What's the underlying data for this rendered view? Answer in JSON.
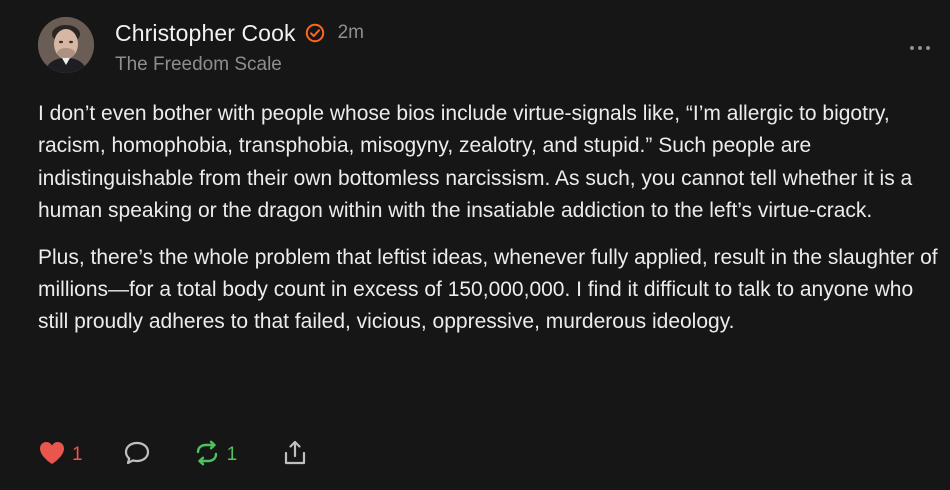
{
  "post": {
    "author_name": "Christopher Cook",
    "timestamp": "2m",
    "publication": "The Freedom Scale",
    "paragraphs": [
      "I don’t even bother with people whose bios include virtue-signals like, “I’m allergic to bigotry, racism, homophobia, transphobia, misogyny, zealotry, and stupid.” Such people are indistinguishable from their own bottomless narcissism. As such, you cannot tell whether it is a human speaking or the dragon within with the insatiable addiction to the left’s virtue-crack.",
      "Plus, there’s the whole problem that leftist ideas, whenever fully applied, result in the slaughter of millions—for a total body count in excess of 150,000,000. I find it difficult to talk to anyone who still proudly adheres to that failed, vicious, oppressive, murderous ideology."
    ]
  },
  "actions": {
    "like_count": "1",
    "restack_count": "1"
  },
  "icons": {
    "verified": "verified-badge-icon",
    "more": "more-options-icon",
    "like": "heart-icon",
    "comment": "comment-bubble-icon",
    "restack": "restack-icon",
    "share": "share-icon"
  },
  "colors": {
    "background": "#161616",
    "text": "#ececec",
    "muted": "#8e8e8e",
    "verified": "#ff6719",
    "like": "#e8564e",
    "restack": "#4cc35e"
  }
}
